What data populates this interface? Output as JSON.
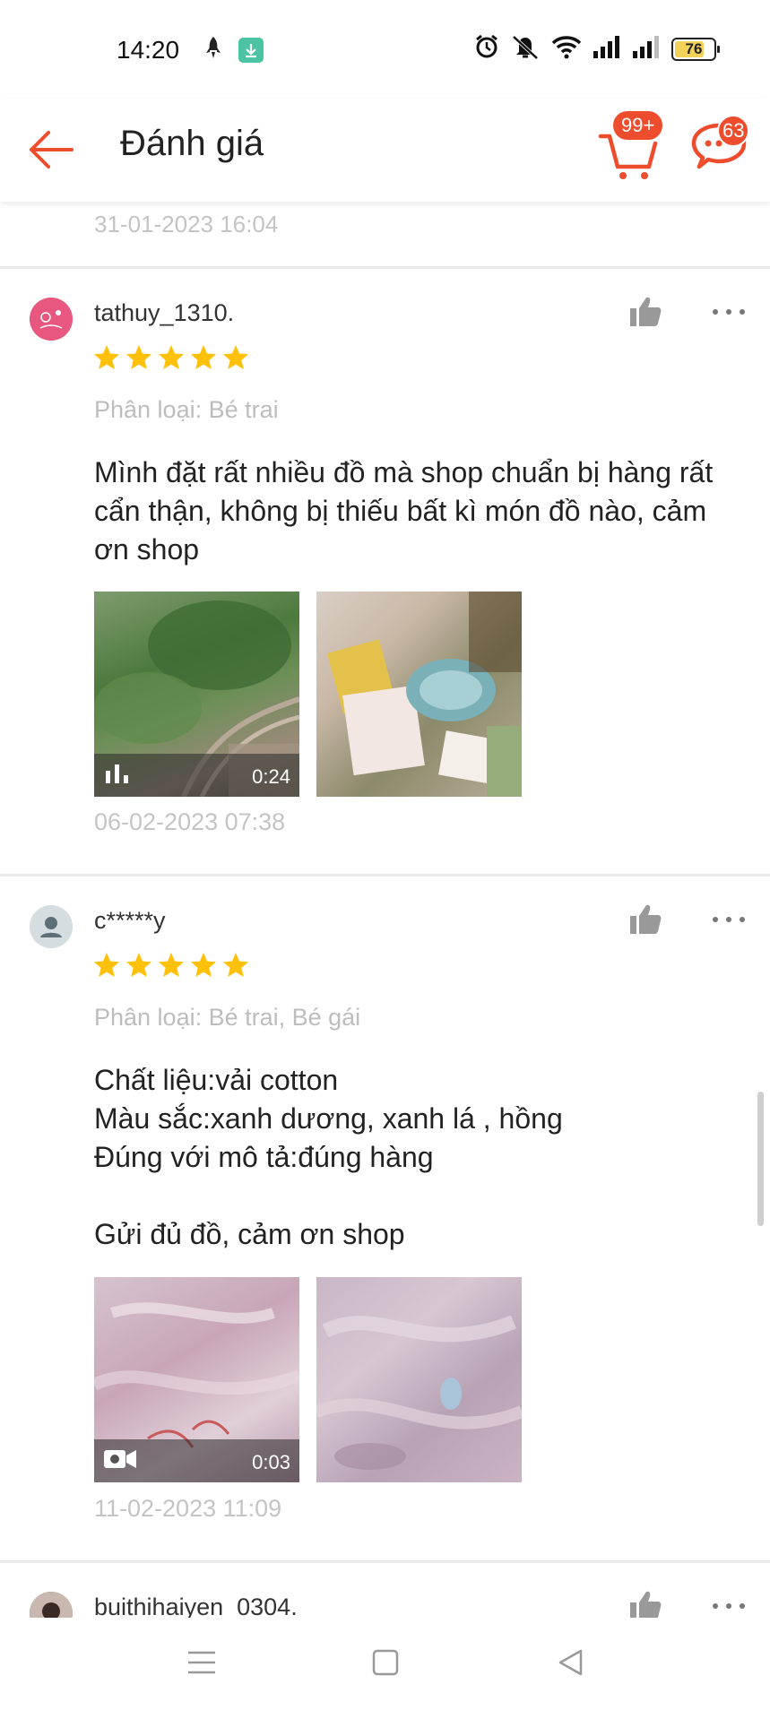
{
  "status_bar": {
    "time": "14:20",
    "battery": "76",
    "icons": [
      "rocket-icon",
      "download-icon",
      "alarm-icon",
      "mute-icon",
      "wifi-icon",
      "signal-icon",
      "signal-icon"
    ]
  },
  "header": {
    "title": "Đánh giá",
    "cart_badge": "99+",
    "chat_badge": "63",
    "accent_color": "#ee4d2d"
  },
  "previous_review_date": "31-01-2023 16:04",
  "reviews": [
    {
      "username": "tathuy_1310.",
      "stars": 5,
      "variant": "Phân loại: Bé trai",
      "content": "Mình đặt rất nhiều đồ mà shop chuẩn bị hàng rất cẩn thận, không bị thiếu bất kì món đồ nào, cảm ơn shop",
      "media": [
        {
          "type": "video",
          "duration": "0:24"
        },
        {
          "type": "image"
        }
      ],
      "date": "06-02-2023 07:38"
    },
    {
      "username": "c*****y",
      "stars": 5,
      "variant": "Phân loại: Bé trai, Bé gái",
      "content": "Chất liệu:vải cotton\nMàu sắc:xanh dương, xanh lá , hồng\nĐúng với mô tả:đúng hàng\n\nGửi đủ đồ, cảm ơn shop",
      "media": [
        {
          "type": "video",
          "duration": "0:03"
        },
        {
          "type": "image"
        }
      ],
      "date": "11-02-2023 11:09"
    },
    {
      "username": "buithihaiyen_0304."
    }
  ],
  "star_color": "#ffc107"
}
